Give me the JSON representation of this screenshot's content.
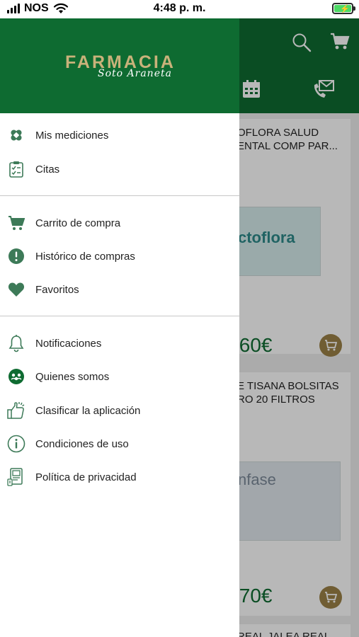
{
  "status_bar": {
    "carrier": "NOS",
    "time": "4:48 p. m."
  },
  "brand": {
    "name": "FARMACIA",
    "subname": "Soto Araneta"
  },
  "colors": {
    "primary": "#0e6b31",
    "gold": "#c9b27a",
    "icon": "#3d7a58"
  },
  "menu": {
    "section1": [
      {
        "label": "Mis mediciones",
        "icon": "bandage-icon"
      },
      {
        "label": "Citas",
        "icon": "clipboard-check-icon"
      }
    ],
    "section2": [
      {
        "label": "Carrito de compra",
        "icon": "cart-icon"
      },
      {
        "label": "Histórico de compras",
        "icon": "alert-circle-icon"
      },
      {
        "label": "Favoritos",
        "icon": "heart-icon"
      }
    ],
    "section3": [
      {
        "label": "Notificaciones",
        "icon": "bell-icon"
      },
      {
        "label": "Quienes somos",
        "icon": "team-icon"
      },
      {
        "label": "Clasificar la aplicación",
        "icon": "thumbs-up-icon"
      },
      {
        "label": "Condiciones de uso",
        "icon": "info-icon"
      },
      {
        "label": "Política de privacidad",
        "icon": "policy-icon"
      }
    ]
  },
  "background_products": [
    {
      "title_line1": "OFLORA SALUD",
      "title_line2": "ENTAL COMP PAR...",
      "image_text": "ctoflora",
      "price": ".60€"
    },
    {
      "title_line1": "E TISANA BOLSITAS",
      "title_line2": "RO 20 FILTROS",
      "image_text": "nfase",
      "price": ".70€"
    },
    {
      "title_line1": "REAL JALEA REAL",
      "title_line2": ""
    }
  ]
}
